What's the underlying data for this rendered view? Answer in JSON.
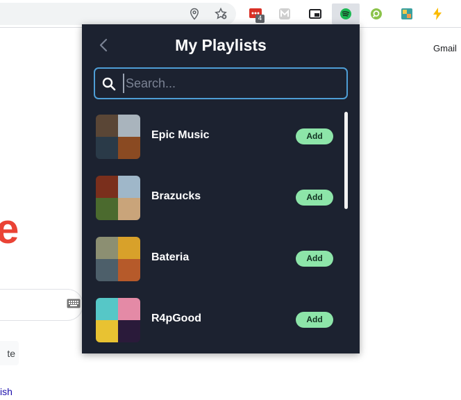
{
  "browser": {
    "extension_badge": "4"
  },
  "background_page": {
    "gmail": "Gmail",
    "logo_fragment": "e",
    "button_fragment": "te",
    "language_fragment": "ish"
  },
  "popup": {
    "title": "My Playlists",
    "search": {
      "placeholder": "Search...",
      "value": ""
    },
    "add_label": "Add",
    "playlists": [
      {
        "name": "Epic Music",
        "cover_colors": [
          "#5a4636",
          "#a9b4bd",
          "#2a3a48",
          "#8a4a22"
        ]
      },
      {
        "name": "Brazucks",
        "cover_colors": [
          "#7a2f1c",
          "#9fb7c9",
          "#4b6a2e",
          "#c9a47a"
        ]
      },
      {
        "name": "Bateria",
        "cover_colors": [
          "#8c8f72",
          "#d8a12a",
          "#4d5f6a",
          "#b65a2a"
        ]
      },
      {
        "name": "R4pGood",
        "cover_colors": [
          "#56c7c7",
          "#e48aa6",
          "#e8c232",
          "#2a1a3a"
        ]
      }
    ]
  },
  "colors": {
    "popup_bg": "#1c2230",
    "accent_border": "#4e9ed6",
    "add_button": "#8de5a9"
  }
}
